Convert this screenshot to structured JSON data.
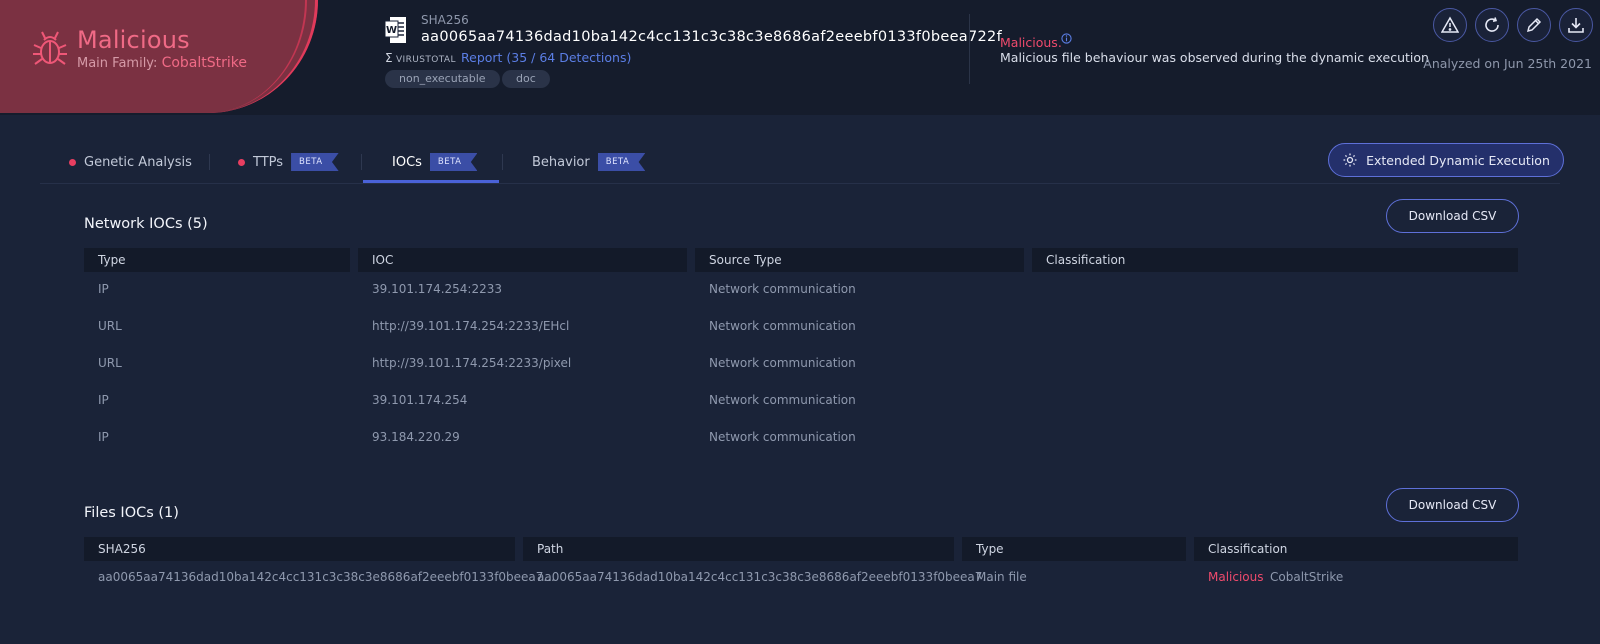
{
  "header": {
    "verdict": "Malicious",
    "family_label": "Main Family:",
    "family": "CobaltStrike",
    "sha_label": "SHA256",
    "sha": "aa0065aa74136dad10ba142c4cc131c3c38c3e8686af2eeebf0133f0beea722f",
    "vt_logo": "VIRUSTOTAL",
    "vt_report": "Report (35 / 64 Detections)",
    "tags": [
      "non_executable",
      "doc"
    ],
    "verdict_note_title": "Malicious.",
    "verdict_note": "Malicious file behaviour was observed during the dynamic execution",
    "analyzed": "Analyzed on Jun 25th 2021",
    "colors": {
      "malicious": "#e13a5b",
      "accent": "#4a62d8"
    }
  },
  "tabs": [
    {
      "label": "Genetic Analysis",
      "dot": true,
      "beta": ""
    },
    {
      "label": "TTPs",
      "dot": true,
      "beta": "BETA"
    },
    {
      "label": "IOCs",
      "dot": false,
      "beta": "BETA",
      "active": true
    },
    {
      "label": "Behavior",
      "dot": false,
      "beta": "BETA"
    }
  ],
  "extended_button": "Extended Dynamic Execution",
  "network": {
    "title": "Network IOCs (5)",
    "download": "Download CSV",
    "columns": [
      "Type",
      "IOC",
      "Source Type",
      "Classification"
    ],
    "rows": [
      [
        "IP",
        "39.101.174.254:2233",
        "Network communication",
        ""
      ],
      [
        "URL",
        "http://39.101.174.254:2233/EHcl",
        "Network communication",
        ""
      ],
      [
        "URL",
        "http://39.101.174.254:2233/pixel",
        "Network communication",
        ""
      ],
      [
        "IP",
        "39.101.174.254",
        "Network communication",
        ""
      ],
      [
        "IP",
        "93.184.220.29",
        "Network communication",
        ""
      ]
    ]
  },
  "files": {
    "title": "Files IOCs (1)",
    "download": "Download CSV",
    "columns": [
      "SHA256",
      "Path",
      "Type",
      "Classification"
    ],
    "rows": [
      {
        "sha": "aa0065aa74136dad10ba142c4cc131c3c38c3e8686af2eeebf0133f0beea7...",
        "path": "aa0065aa74136dad10ba142c4cc131c3c38c3e8686af2eeebf0133f0beea7...",
        "type": "Main file",
        "classification": "Malicious",
        "family": "CobaltStrike"
      }
    ]
  }
}
